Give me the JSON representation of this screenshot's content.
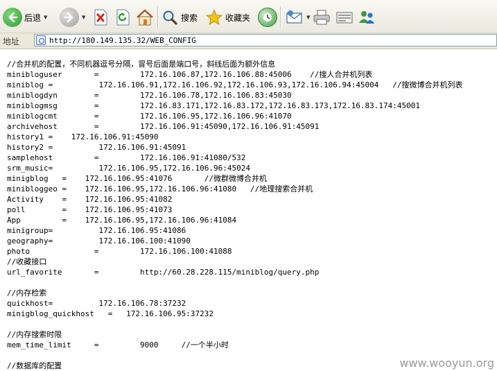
{
  "toolbar": {
    "back_label": "后退",
    "search_label": "搜索",
    "favorites_label": "收藏夹"
  },
  "address": {
    "label": "地址",
    "url": "http://180.149.135.32/WEB_CONFIG"
  },
  "content": {
    "lines": [
      "//合并机的配置，不同机器逗号分隔，冒号后面是端口号，斜线后面为额外信息",
      "minibloguser       =         172.16.106.87,172.16.106.88:45006    //搜人合并机列表",
      "miniblog =          172.16.106.91,172.16.106.92,172.16.106.93,172.16.106.94:45004   //搜微博合并机列表",
      "miniblogdyn        =         172.16.106.78,172.16.106.83:45030",
      "miniblogmsg        =         172.16.83.171,172.16.83.172,172.16.83.173,172.16.83.174:45001",
      "miniblogcmt        =         172.16.106.95,172.16.106.96:41070",
      "archivehost        =         172.16.106.91:45090,172.16.106.91:45091",
      "history1 =    172.16.106.91:45090",
      "history2 =          172.16.106.91:45091",
      "samplehost         =         172.16.106.91:41080/532",
      "srm_music=          172.16.106.95,172.16.106.96:45024",
      "minigblog   =    172.16.106.95:41076       //微群微博合并机",
      "minibloggeo =    172.16.106.95,172.16.106.96:41080   //地理搜索合并机",
      "Activity    =    172.16.106.95:41082",
      "poll        =    172.16.106.95:41073",
      "App         =    172.16.106.95,172.16.106.96:41084",
      "minigroup=          172.16.106.95:41086",
      "geography=          172.16.106.100:41090",
      "photo              =         172.16.106.100:41088",
      "//收藏接口",
      "url_favorite       =         http://60.28.228.115/miniblog/query.php",
      "",
      "//内存检索",
      "quickhost=          172.16.106.78:37232",
      "minigblog_quickhost   =   172.16.106.95:37232",
      "",
      "//内存搜索时限",
      "mem_time_limit     =         9000     //一个半小时",
      "",
      "//数据库的配置"
    ]
  },
  "watermark": "www.wooyun.org",
  "colors": {
    "back_icon": "#2f9e2f",
    "forward_icon": "#9a9a9a",
    "stop_icon": "#d42a1a",
    "refresh_icon": "#2f9e2f",
    "star_icon": "#f2c318"
  }
}
